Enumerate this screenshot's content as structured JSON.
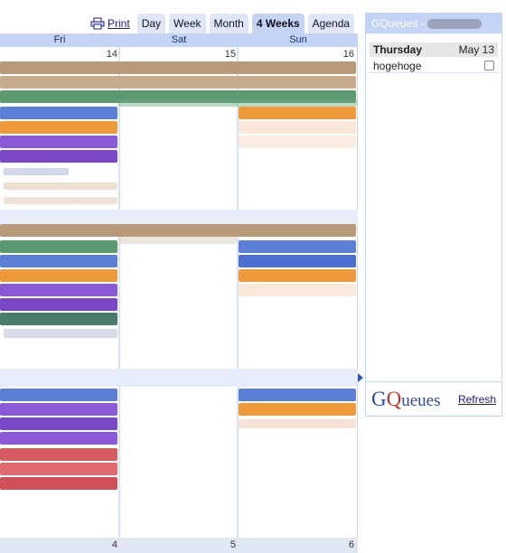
{
  "toolbar": {
    "print_label": "Print",
    "print_icon": "printer-icon",
    "tabs": [
      {
        "label": "Day"
      },
      {
        "label": "Week"
      },
      {
        "label": "Month"
      },
      {
        "label": "4 Weeks",
        "active": true
      },
      {
        "label": "Agenda"
      }
    ]
  },
  "calendar": {
    "weekdays": [
      "Fri",
      "Sat",
      "Sun"
    ],
    "weeks": [
      {
        "days": [
          "14",
          "15",
          "16"
        ]
      },
      {
        "days": [
          "4",
          "5",
          "6"
        ]
      }
    ],
    "colors": {
      "tan": "#b89a78",
      "green": "#5a9a6e",
      "blue": "#5a7fd4",
      "orange": "#ee9a3a",
      "purple": "#8a5ad6",
      "red": "#d85a62",
      "teal": "#4a7c6a"
    },
    "next_arrow_icon": "chevron-right-icon"
  },
  "gqueues": {
    "title": "GQueues -",
    "day_label": "Thursday",
    "date_label": "May 13",
    "tasks": [
      {
        "name": "hogehoge"
      }
    ],
    "logo_text": "GQueues",
    "refresh_label": "Refresh"
  }
}
